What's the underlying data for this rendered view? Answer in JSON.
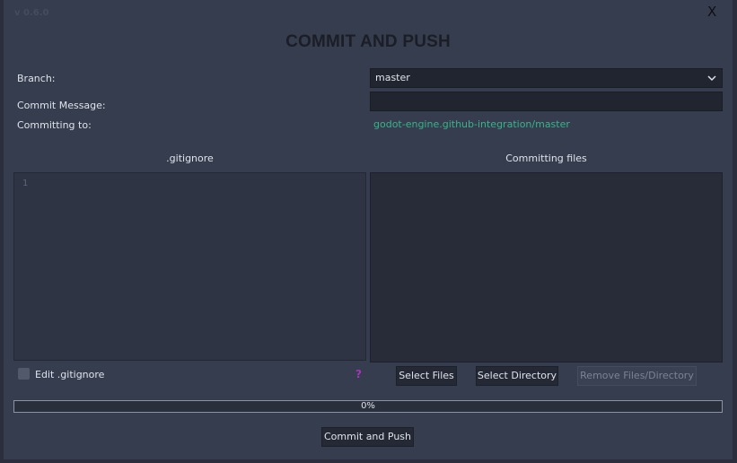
{
  "window": {
    "version": "v 0.6.0",
    "close_label": "X",
    "title": "COMMIT AND PUSH"
  },
  "form": {
    "branch_label": "Branch:",
    "branch_value": "master",
    "commit_message_label": "Commit Message:",
    "commit_message_value": "",
    "committing_to_label": "Committing to:",
    "committing_to_value": "godot-engine.github-integration/master"
  },
  "gitignore": {
    "title": ".gitignore",
    "line_numbers": [
      "1"
    ],
    "edit_checkbox_label": "Edit .gitignore",
    "edit_checked": false,
    "help_icon": "?"
  },
  "files": {
    "title": "Committing files",
    "items": [],
    "select_files_label": "Select Files",
    "select_directory_label": "Select Directory",
    "remove_label": "Remove Files/Directory"
  },
  "progress": {
    "value_percent": 0,
    "label": "0%"
  },
  "actions": {
    "commit_push_label": "Commit and Push"
  },
  "colors": {
    "background": "#363d4e",
    "accent_link": "#3bb28a",
    "help": "#a436b8"
  }
}
